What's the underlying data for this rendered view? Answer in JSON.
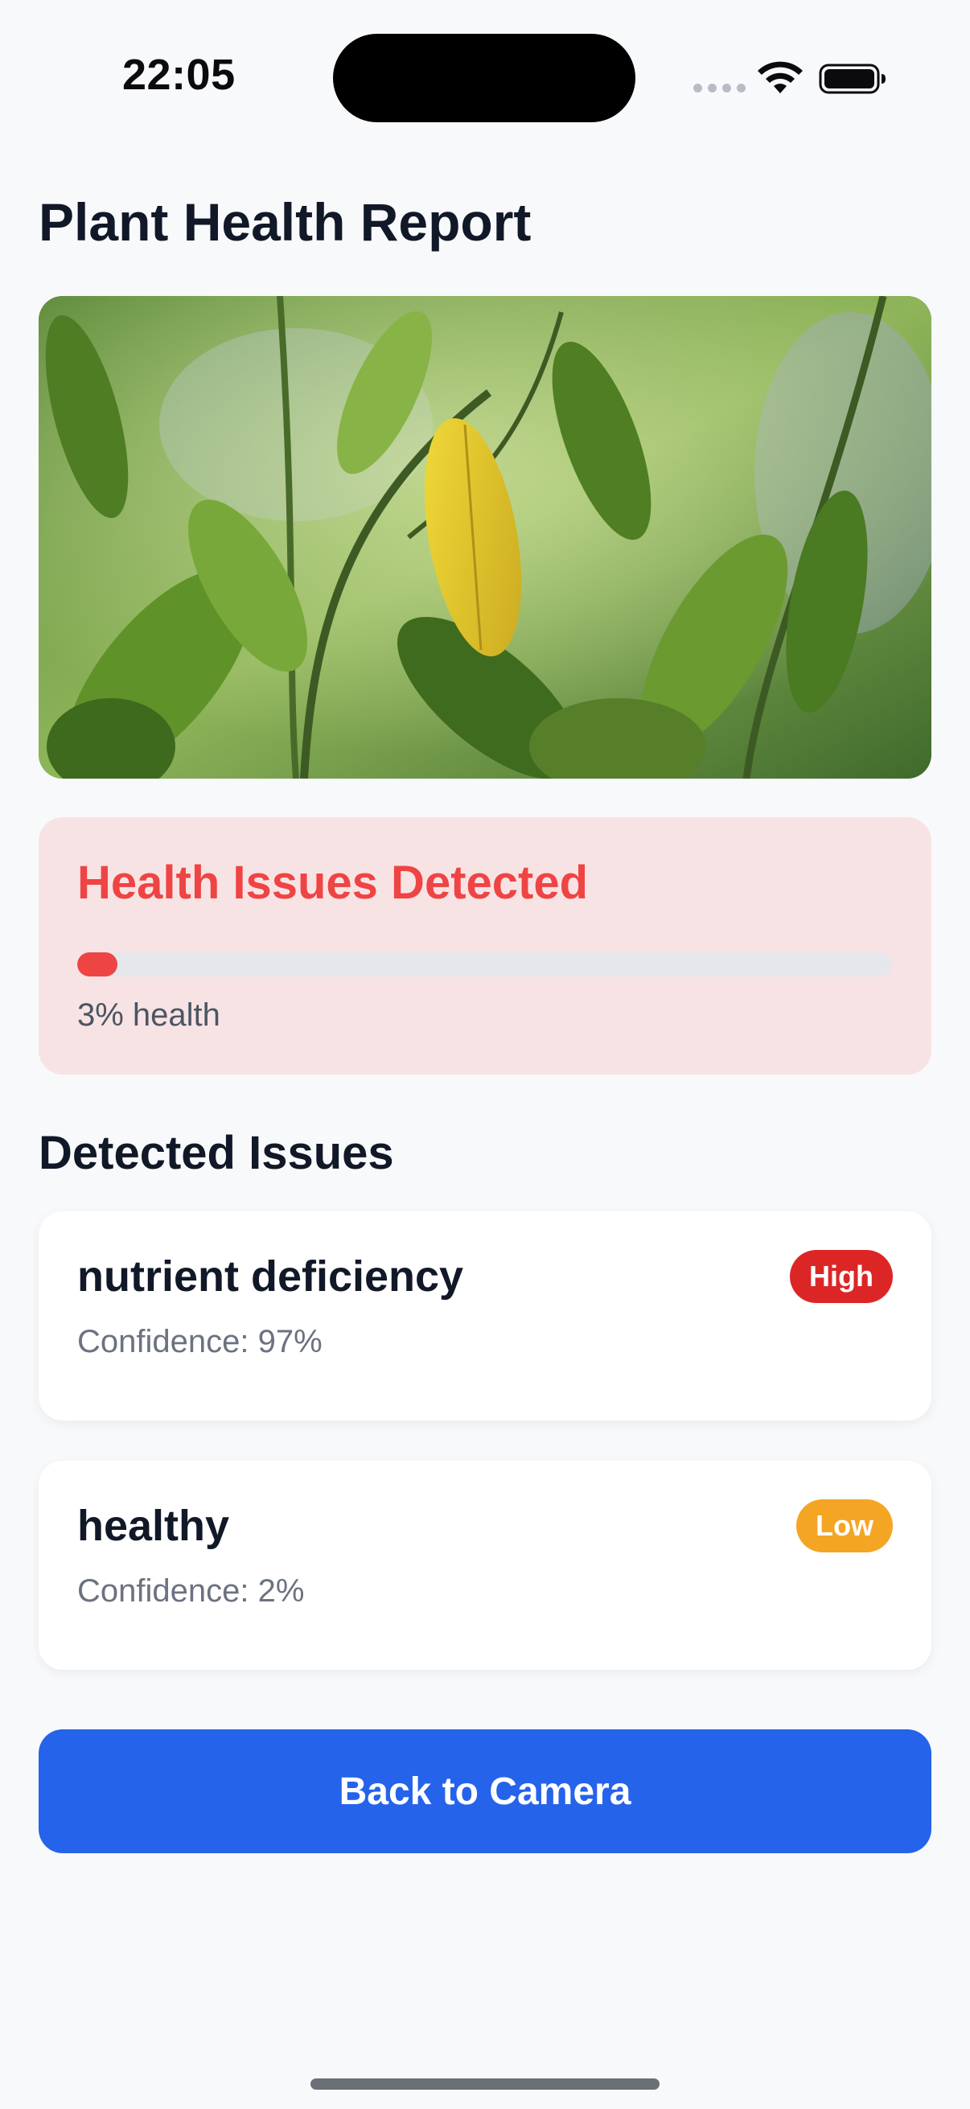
{
  "status_bar": {
    "time": "22:05",
    "icons": [
      "signal-dots-icon",
      "wifi-icon",
      "battery-icon"
    ]
  },
  "header": {
    "title": "Plant Health Report"
  },
  "photo": {
    "subject": "plant-leaves-photo"
  },
  "health": {
    "title": "Health Issues Detected",
    "health_fraction": 0.03,
    "health_text": "3% health",
    "accent_color": "#ef4444",
    "card_background": "#f8e3e4"
  },
  "issues_section": {
    "title": "Detected Issues",
    "items": [
      {
        "name": "nutrient deficiency",
        "confidence_text": "Confidence: 97%",
        "severity": "High",
        "severity_color": "#dc2626"
      },
      {
        "name": "healthy",
        "confidence_text": "Confidence: 2%",
        "severity": "Low",
        "severity_color": "#f5a524"
      }
    ]
  },
  "actions": {
    "back_label": "Back to Camera",
    "button_color": "#2563eb"
  }
}
